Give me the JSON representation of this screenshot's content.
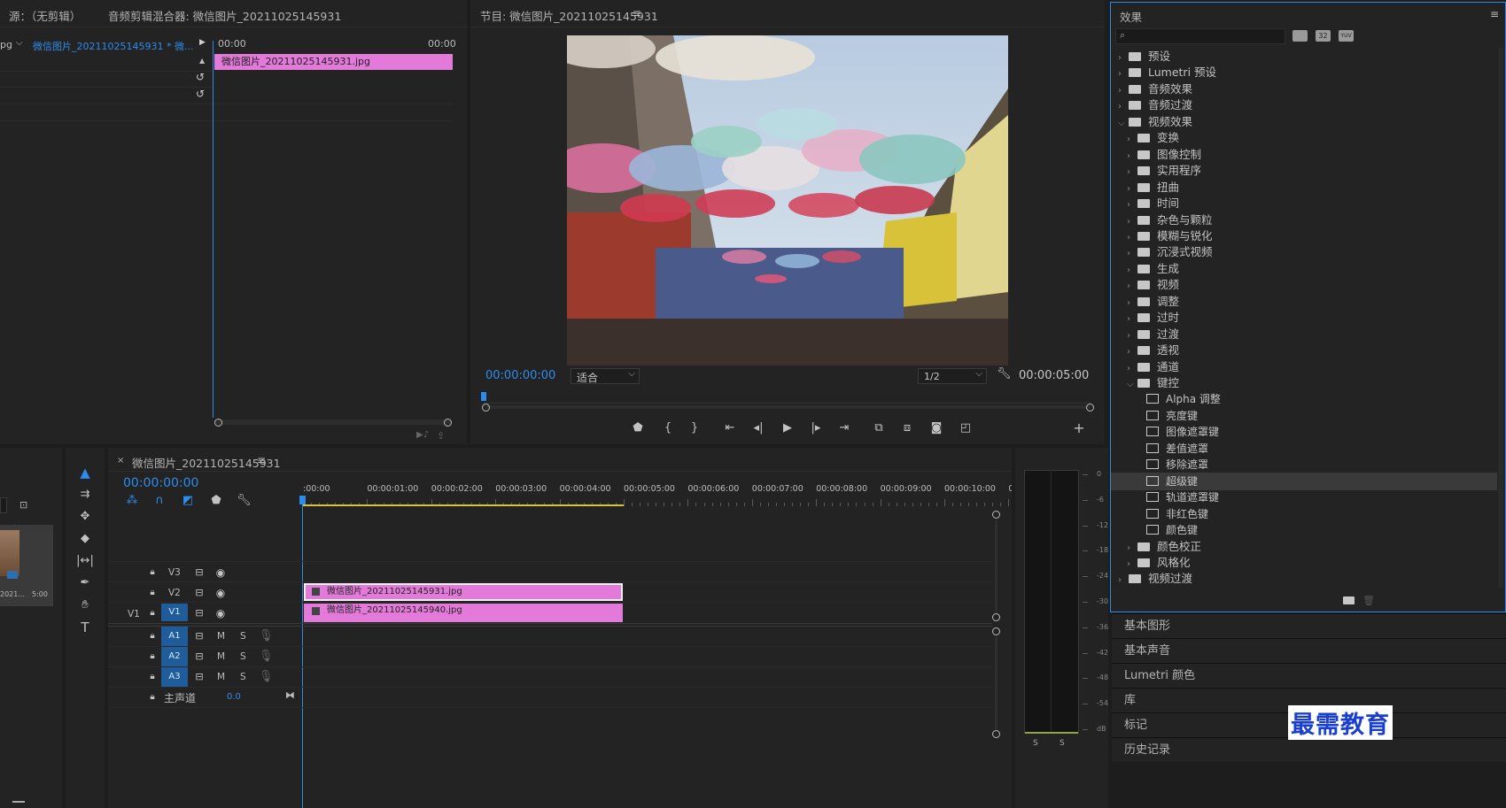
{
  "source_panel": {
    "tab_source": "源：（无剪辑）",
    "tab_mixer": "音频剪辑混合器: 微信图片_20211025145931",
    "clip_prefix": "pg",
    "clip_select": "微信图片_20211025145931 * 微...",
    "time_start": "00:00",
    "time_end": "00:00",
    "clip_label": "微信图片_20211025145931.jpg"
  },
  "program_monitor": {
    "title": "节目: 微信图片_20211025145931",
    "timecode_current": "00:00:00:00",
    "fit": "适合",
    "resolution": "1/2",
    "timecode_duration": "00:00:05:00"
  },
  "project_panel": {
    "thumb_name": "2021...",
    "thumb_duration": "5:00"
  },
  "timeline": {
    "sequence_tab": "微信图片_20211025145931",
    "timecode": "00:00:00:00",
    "ruler": [
      ":00:00",
      "00:00:01:00",
      "00:00:02:00",
      "00:00:03:00",
      "00:00:04:00",
      "00:00:05:00",
      "00:00:06:00",
      "00:00:07:00",
      "00:00:08:00",
      "00:00:09:00",
      "00:00:10:00",
      "0"
    ],
    "video_tracks": [
      "V3",
      "V2",
      "V1"
    ],
    "source_patch": "V1",
    "audio_tracks": [
      "A1",
      "A2",
      "A3"
    ],
    "m_label": "M",
    "s_label": "S",
    "master_label": "主声道",
    "master_value": "0.0",
    "clip_v2": "微信图片_20211025145931.jpg",
    "clip_v1": "微信图片_20211025145940.jpg"
  },
  "meter": {
    "scale": [
      "0",
      "-6",
      "-12",
      "-18",
      "-24",
      "-30",
      "-36",
      "-42",
      "-48",
      "-54",
      "dB"
    ],
    "footer_l": "S",
    "footer_r": "S"
  },
  "effects": {
    "title": "效果",
    "search_placeholder": "",
    "badge_32": "32",
    "badge_yuv": "YUV",
    "tree": [
      {
        "label": "预设",
        "level": 0,
        "type": "preset-folder",
        "open": false
      },
      {
        "label": "Lumetri 预设",
        "level": 0,
        "type": "preset-folder",
        "open": false
      },
      {
        "label": "音频效果",
        "level": 0,
        "type": "folder",
        "open": false
      },
      {
        "label": "音频过渡",
        "level": 0,
        "type": "folder",
        "open": false
      },
      {
        "label": "视频效果",
        "level": 0,
        "type": "folder",
        "open": true
      },
      {
        "label": "变换",
        "level": 1,
        "type": "folder",
        "open": false
      },
      {
        "label": "图像控制",
        "level": 1,
        "type": "folder",
        "open": false
      },
      {
        "label": "实用程序",
        "level": 1,
        "type": "folder",
        "open": false
      },
      {
        "label": "扭曲",
        "level": 1,
        "type": "folder",
        "open": false
      },
      {
        "label": "时间",
        "level": 1,
        "type": "folder",
        "open": false
      },
      {
        "label": "杂色与颗粒",
        "level": 1,
        "type": "folder",
        "open": false
      },
      {
        "label": "模糊与锐化",
        "level": 1,
        "type": "folder",
        "open": false
      },
      {
        "label": "沉浸式视频",
        "level": 1,
        "type": "folder",
        "open": false
      },
      {
        "label": "生成",
        "level": 1,
        "type": "folder",
        "open": false
      },
      {
        "label": "视频",
        "level": 1,
        "type": "folder",
        "open": false
      },
      {
        "label": "调整",
        "level": 1,
        "type": "folder",
        "open": false
      },
      {
        "label": "过时",
        "level": 1,
        "type": "folder",
        "open": false
      },
      {
        "label": "过渡",
        "level": 1,
        "type": "folder",
        "open": false
      },
      {
        "label": "透视",
        "level": 1,
        "type": "folder",
        "open": false
      },
      {
        "label": "通道",
        "level": 1,
        "type": "folder",
        "open": false
      },
      {
        "label": "键控",
        "level": 1,
        "type": "folder",
        "open": true
      },
      {
        "label": "Alpha 调整",
        "level": 2,
        "type": "effect"
      },
      {
        "label": "亮度键",
        "level": 2,
        "type": "effect"
      },
      {
        "label": "图像遮罩键",
        "level": 2,
        "type": "effect"
      },
      {
        "label": "差值遮罩",
        "level": 2,
        "type": "effect"
      },
      {
        "label": "移除遮罩",
        "level": 2,
        "type": "effect"
      },
      {
        "label": "超级键",
        "level": 2,
        "type": "effect",
        "selected": true
      },
      {
        "label": "轨道遮罩键",
        "level": 2,
        "type": "effect"
      },
      {
        "label": "非红色键",
        "level": 2,
        "type": "effect"
      },
      {
        "label": "颜色键",
        "level": 2,
        "type": "effect"
      },
      {
        "label": "颜色校正",
        "level": 1,
        "type": "folder",
        "open": false
      },
      {
        "label": "风格化",
        "level": 1,
        "type": "folder",
        "open": false
      },
      {
        "label": "视频过渡",
        "level": 0,
        "type": "folder",
        "open": false
      }
    ]
  },
  "side_panels": [
    "基本图形",
    "基本声音",
    "Lumetri 颜色",
    "库",
    "标记",
    "历史记录"
  ],
  "watermark": "最需教育",
  "colors": {
    "accent": "#2d8ceb",
    "clip": "#e37ad9",
    "track_on": "#1f5c99"
  }
}
